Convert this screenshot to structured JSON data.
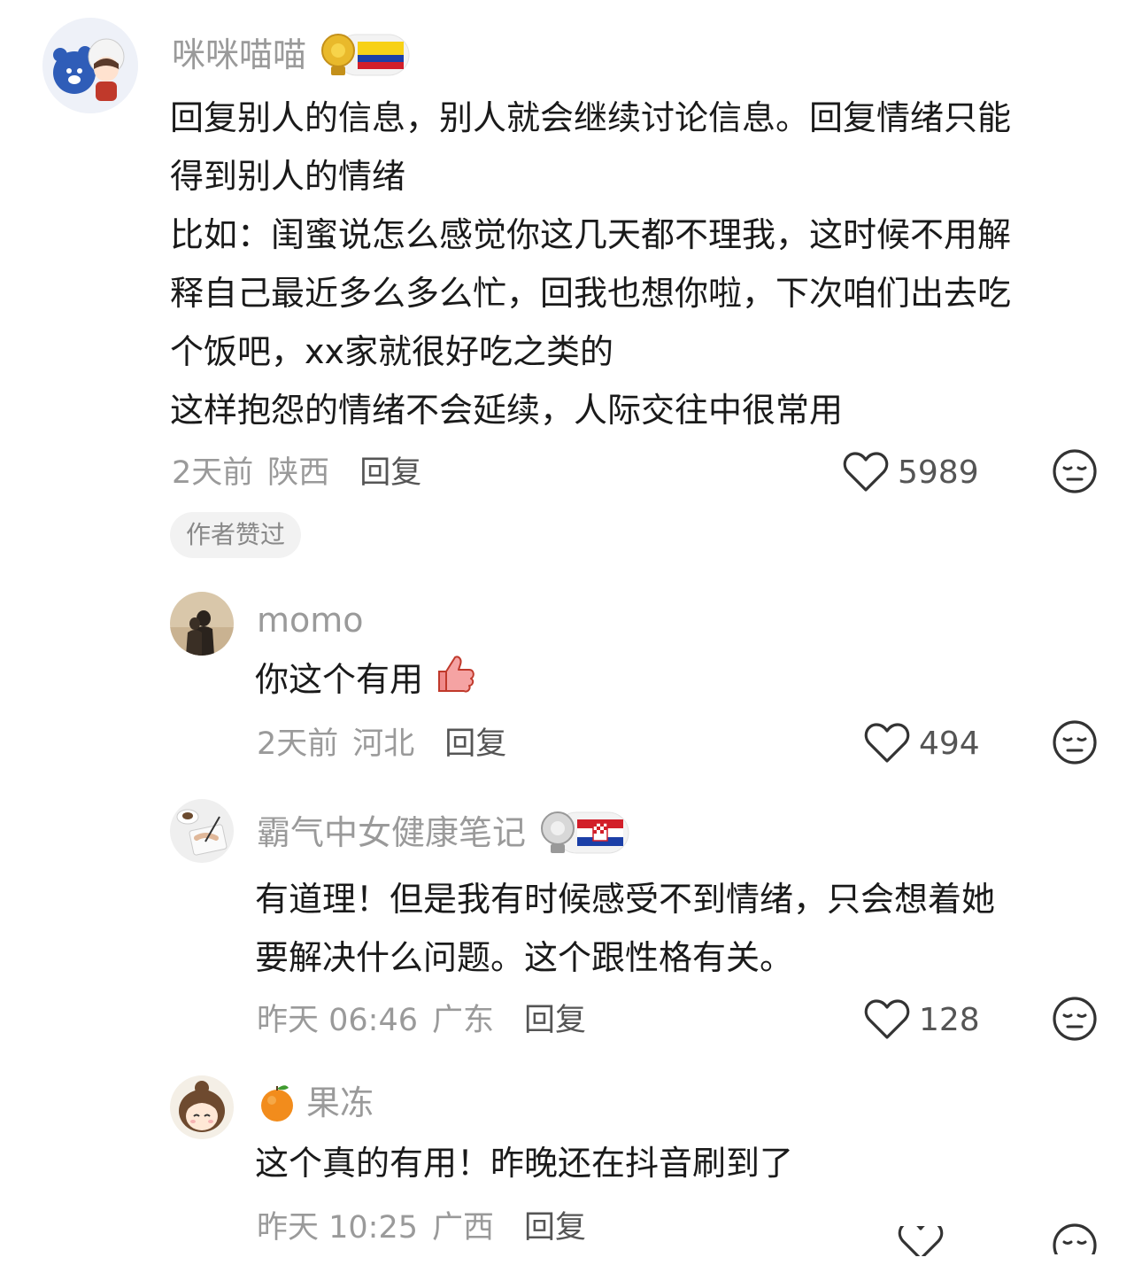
{
  "comments": [
    {
      "username": "咪咪喵喵",
      "lines": [
        "回复别人的信息，别人就会继续讨论信息。回复情绪只能",
        "得到别人的情绪",
        "比如：闺蜜说怎么感觉你这几天都不理我，这时候不用解",
        "释自己最近多么多么忙，回我也想你啦，下次咱们出去吃",
        "个饭吧，xx家就很好吃之类的",
        "这样抱怨的情绪不会延续，人际交往中很常用"
      ],
      "time": "2天前",
      "location": "陕西",
      "reply": "回复",
      "likes": "5989",
      "tag": "作者赞过",
      "badge_icon": "colombia-flag-trophy-badge"
    },
    {
      "username": "momo",
      "text": "你这个有用",
      "emoji_icon": "thumbs-up-icon",
      "time": "2天前",
      "location": "河北",
      "reply": "回复",
      "likes": "494"
    },
    {
      "username": "霸气中女健康笔记",
      "lines": [
        "有道理！但是我有时候感受不到情绪，只会想着她",
        "要解决什么问题。这个跟性格有关。"
      ],
      "time": "昨天 06:46",
      "location": "广东",
      "reply": "回复",
      "likes": "128",
      "badge_icon": "croatia-flag-trophy-badge"
    },
    {
      "username": "果冻",
      "name_icon": "orange-icon",
      "text": "这个真的有用！昨晚还在抖音刷到了",
      "time": "昨天 10:25",
      "location": "广西",
      "reply": "回复"
    }
  ],
  "colors": {
    "username": "#9a9a9a",
    "text": "#1a1a1a",
    "meta": "#9a9a9a",
    "tag_bg": "#f2f2f2"
  }
}
